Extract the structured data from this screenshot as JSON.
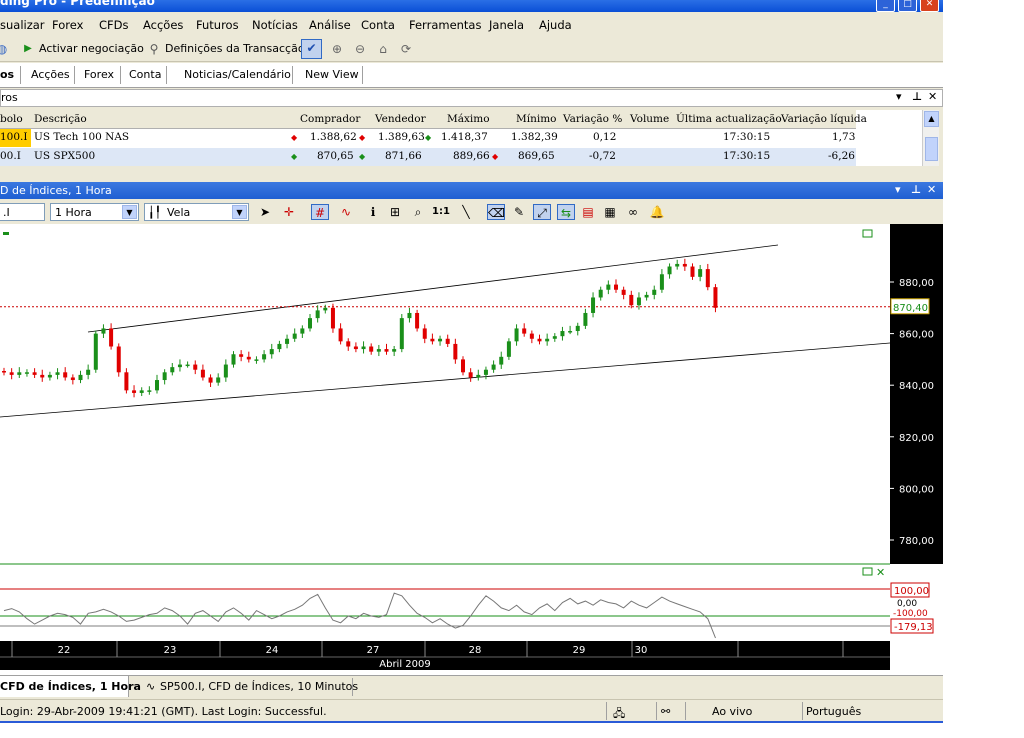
{
  "window": {
    "title": "ding Pro - Predefinição"
  },
  "menu": [
    "sualizar",
    "Forex",
    "CFDs",
    "Acções",
    "Futuros",
    "Notícias",
    "Análise",
    "Conta",
    "Ferramentas",
    "Janela",
    "Ajuda"
  ],
  "toolbar": {
    "activate_label": "Activar negociação",
    "settings_label": "Definições da Transacção"
  },
  "tabs": [
    "os",
    "Acções",
    "Forex",
    "Conta",
    "Noticias/Calendário",
    "New View"
  ],
  "quotes_panel": {
    "title": "ros",
    "columns": [
      "bolo",
      "Descrição",
      "Comprador",
      "Vendedor",
      "Máximo",
      "Mínimo",
      "Variação %",
      "Volume",
      "Última actualização",
      "Variação líquida"
    ],
    "rows": [
      {
        "symbol": "100.I",
        "description": "US Tech 100 NAS",
        "bid": "1.388,62",
        "ask": "1.389,63",
        "high": "1.418,37",
        "low": "1.382,39",
        "change_pct": "0,12",
        "volume": "",
        "last_update": "17:30:15",
        "net_change": "1,73"
      },
      {
        "symbol": "00.I",
        "description": "US SPX500",
        "bid": "870,65",
        "ask": "871,66",
        "high": "889,66",
        "low": "869,65",
        "change_pct": "-0,72",
        "volume": "",
        "last_update": "17:30:15",
        "net_change": "-6,26"
      }
    ]
  },
  "chart_window": {
    "title": "D de Índices, 1 Hora",
    "symbol_value": ".I",
    "timeframe_value": "1 Hora",
    "chart_type_value": "Vela"
  },
  "chart_data": {
    "type": "candlestick",
    "price_axis": {
      "ticks": [
        "880,00",
        "860,00",
        "840,00",
        "820,00",
        "800,00",
        "780,00"
      ],
      "range": [
        770,
        902
      ]
    },
    "current_price_label": "870,40",
    "current_price": 870.4,
    "indicator_labels": {
      "upper": "100,00",
      "zero": "0,00",
      "lower_hidden": "-100,00",
      "value": "-179,13"
    },
    "date_axis": {
      "ticks": [
        "22",
        "23",
        "24",
        "27",
        "28",
        "29",
        "30"
      ],
      "month": "Abril 2009"
    },
    "closes": [
      845,
      844,
      845,
      845,
      844,
      843,
      844,
      845,
      843,
      842,
      844,
      846,
      860,
      862,
      855,
      845,
      838,
      837,
      838,
      838,
      842,
      845,
      847,
      848,
      848,
      846,
      843,
      841,
      843,
      848,
      852,
      851,
      850,
      850,
      852,
      854,
      856,
      858,
      860,
      862,
      866,
      869,
      870,
      862,
      857,
      855,
      854,
      855,
      853,
      854,
      853,
      854,
      866,
      868,
      862,
      858,
      857,
      858,
      856,
      850,
      845,
      843,
      844,
      846,
      848,
      851,
      857,
      862,
      860,
      858,
      857,
      858,
      859,
      861,
      861,
      863,
      868,
      874,
      877,
      879,
      877,
      875,
      871,
      874,
      875,
      877,
      883,
      886,
      887,
      886,
      882,
      885,
      878,
      870
    ],
    "cci": [
      40,
      55,
      30,
      -20,
      -60,
      -30,
      0,
      20,
      10,
      -10,
      -60,
      20,
      30,
      50,
      30,
      0,
      -40,
      -30,
      -10,
      10,
      20,
      60,
      40,
      0,
      -60,
      20,
      40,
      0,
      -40,
      30,
      60,
      20,
      -30,
      40,
      10,
      -20,
      0,
      30,
      50,
      80,
      130,
      160,
      60,
      -30,
      -50,
      0,
      -20,
      20,
      0,
      -10,
      10,
      170,
      150,
      80,
      20,
      -10,
      -50,
      -20,
      -60,
      -90,
      -70,
      0,
      80,
      150,
      110,
      60,
      40,
      80,
      30,
      10,
      60,
      90,
      40,
      100,
      130,
      90,
      110,
      80,
      120,
      100,
      90,
      60,
      110,
      80,
      60,
      100,
      140,
      110,
      90,
      70,
      50,
      30,
      -20,
      -179
    ]
  },
  "bottom_tabs": [
    "CFD de Índices, 1 Hora",
    "SP500.I, CFD de Índices, 10 Minutos"
  ],
  "status": {
    "login": "Login: 29-Abr-2009 19:41:21 (GMT). Last Login: Successful.",
    "connection": "Ao vivo",
    "language": "Português"
  },
  "colors": {
    "bull": "#1a8f1a",
    "bear": "#e00000",
    "current_price_line": "#cc0000",
    "window_blue": "#1f5fd2"
  }
}
